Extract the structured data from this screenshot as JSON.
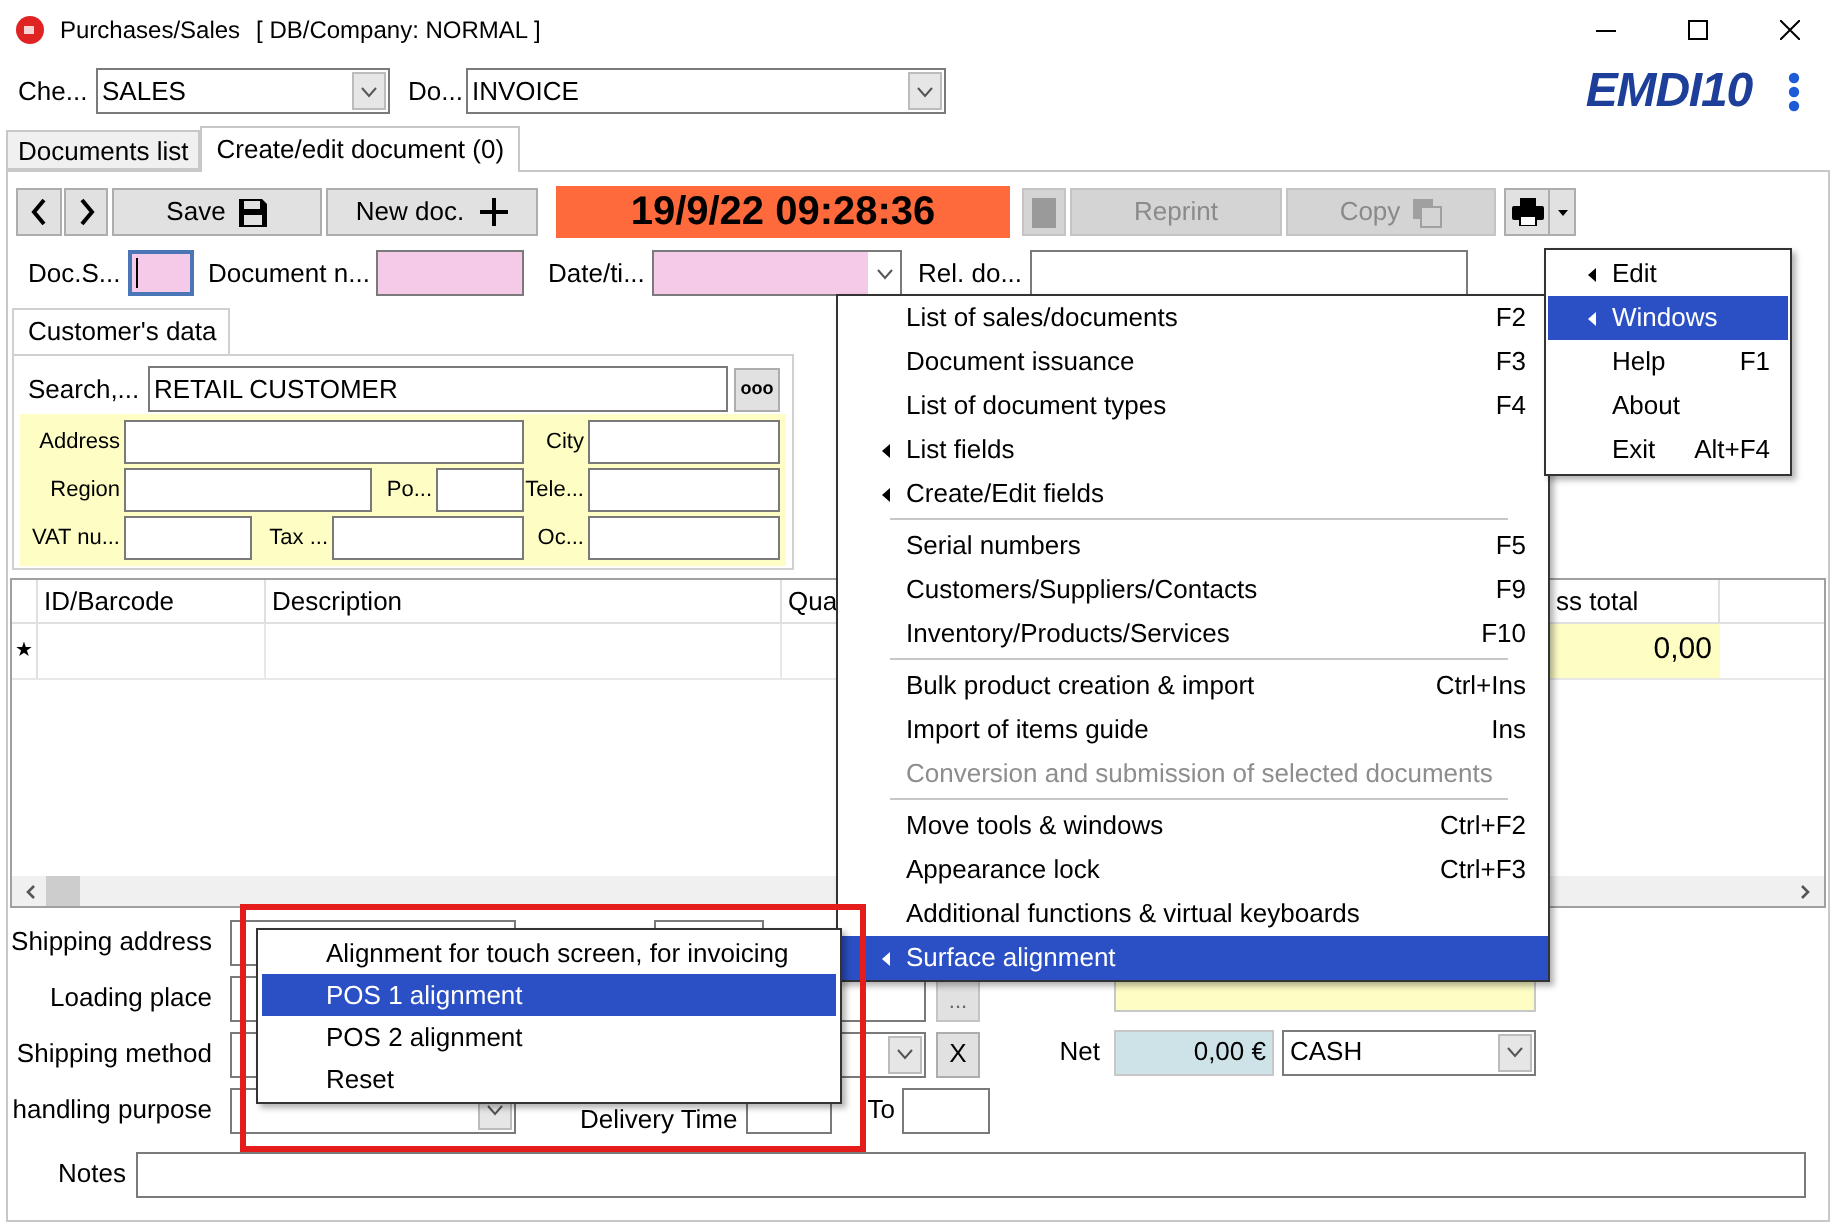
{
  "window": {
    "title": "Purchases/Sales",
    "subtitle": "[ DB/Company: NORMAL ]"
  },
  "selectors": [
    {
      "label": "Che...",
      "value": "SALES"
    },
    {
      "label": "Do...",
      "value": "INVOICE"
    }
  ],
  "logo": {
    "text": "EMDI10"
  },
  "tabs": [
    {
      "label": "Documents list",
      "selected": false
    },
    {
      "label": "Create/edit document (0)",
      "selected": true
    }
  ],
  "toolbar": {
    "save": "Save",
    "new_doc": "New doc.",
    "datetime": "19/9/22 09:28:36",
    "reprint": {
      "label": "Reprint",
      "disabled": true
    },
    "copy": {
      "label": "Copy",
      "disabled": true
    }
  },
  "doc_fields": [
    {
      "label": "Doc.S...",
      "kind": "text",
      "required": true,
      "focused": true
    },
    {
      "label": "Document n...",
      "kind": "text",
      "required": true,
      "focused": false
    },
    {
      "label": "Date/ti...",
      "kind": "dropdown",
      "required": true,
      "focused": false
    },
    {
      "label": "Rel. do...",
      "kind": "text",
      "required": false,
      "focused": false
    }
  ],
  "customer": {
    "tab": "Customer's data",
    "search_label": "Search,...",
    "search_value": "RETAIL CUSTOMER",
    "browse_button": "ooo",
    "fields": [
      {
        "label": "Address"
      },
      {
        "label": "City"
      },
      {
        "label": "Region"
      },
      {
        "label": "Po..."
      },
      {
        "label": "Tele..."
      },
      {
        "label": "VAT nu..."
      },
      {
        "label": "Tax ..."
      },
      {
        "label": "Oc..."
      }
    ]
  },
  "grid": {
    "columns": [
      "ID/Barcode",
      "Description",
      "Qua",
      "ss total"
    ],
    "rows": [
      {
        "marker": "★",
        "total": "0,00"
      }
    ]
  },
  "shipping": [
    {
      "label": "Shipping address",
      "kind": "double"
    },
    {
      "label": "Loading place",
      "kind": "browse",
      "button": "..."
    },
    {
      "label": "Shipping method",
      "kind": "combo_clear",
      "button": "X"
    },
    {
      "label": "handling purpose",
      "kind": "combo_time",
      "time_label": "Delivery Time",
      "to_label": "To"
    }
  ],
  "totals": {
    "net_label": "Net",
    "net_value": "0,00 €",
    "payment": "CASH"
  },
  "notes": {
    "label": "Notes"
  },
  "main_menu": {
    "groups": [
      [
        {
          "label": "List of sales/documents",
          "shortcut": "F2",
          "submenu": false,
          "disabled": false,
          "selected": false
        },
        {
          "label": "Document issuance",
          "shortcut": "F3",
          "submenu": false,
          "disabled": false,
          "selected": false
        },
        {
          "label": "List of document types",
          "shortcut": "F4",
          "submenu": false,
          "disabled": false,
          "selected": false
        },
        {
          "label": "List fields",
          "submenu": true,
          "disabled": false,
          "selected": false
        },
        {
          "label": "Create/Edit fields",
          "submenu": true,
          "disabled": false,
          "selected": false
        }
      ],
      [
        {
          "label": "Serial numbers",
          "shortcut": "F5",
          "submenu": false,
          "disabled": false,
          "selected": false
        },
        {
          "label": "Customers/Suppliers/Contacts",
          "shortcut": "F9",
          "submenu": false,
          "disabled": false,
          "selected": false
        },
        {
          "label": "Inventory/Products/Services",
          "shortcut": "F10",
          "submenu": false,
          "disabled": false,
          "selected": false
        }
      ],
      [
        {
          "label": "Bulk product creation & import",
          "shortcut": "Ctrl+Ins",
          "submenu": false,
          "disabled": false,
          "selected": false
        },
        {
          "label": "Import of items guide",
          "shortcut": "Ins",
          "submenu": false,
          "disabled": false,
          "selected": false
        },
        {
          "label": "Conversion and submission of selected documents",
          "submenu": false,
          "disabled": true,
          "selected": false
        }
      ],
      [
        {
          "label": "Move tools & windows",
          "shortcut": "Ctrl+F2",
          "submenu": false,
          "disabled": false,
          "selected": false
        },
        {
          "label": "Appearance lock",
          "shortcut": "Ctrl+F3",
          "submenu": false,
          "disabled": false,
          "selected": false
        },
        {
          "label": "Additional functions & virtual keyboards",
          "submenu": false,
          "disabled": false,
          "selected": false
        },
        {
          "label": "Surface alignment",
          "submenu": true,
          "disabled": false,
          "selected": true
        }
      ]
    ]
  },
  "side_menu": {
    "items": [
      {
        "label": "Edit",
        "submenu": true,
        "selected": false
      },
      {
        "label": "Windows",
        "submenu": true,
        "selected": true
      },
      {
        "label": "Help",
        "shortcut": "F1",
        "submenu": false,
        "selected": false
      },
      {
        "label": "About",
        "submenu": false,
        "selected": false
      },
      {
        "label": "Exit",
        "shortcut": "Alt+F4",
        "submenu": false,
        "selected": false
      }
    ]
  },
  "popup_menu": {
    "items": [
      {
        "label": "Alignment for touch screen, for invoicing",
        "selected": false
      },
      {
        "label": "POS 1 alignment",
        "selected": true
      },
      {
        "label": "POS 2 alignment",
        "selected": false
      },
      {
        "label": "Reset",
        "selected": false
      }
    ]
  }
}
